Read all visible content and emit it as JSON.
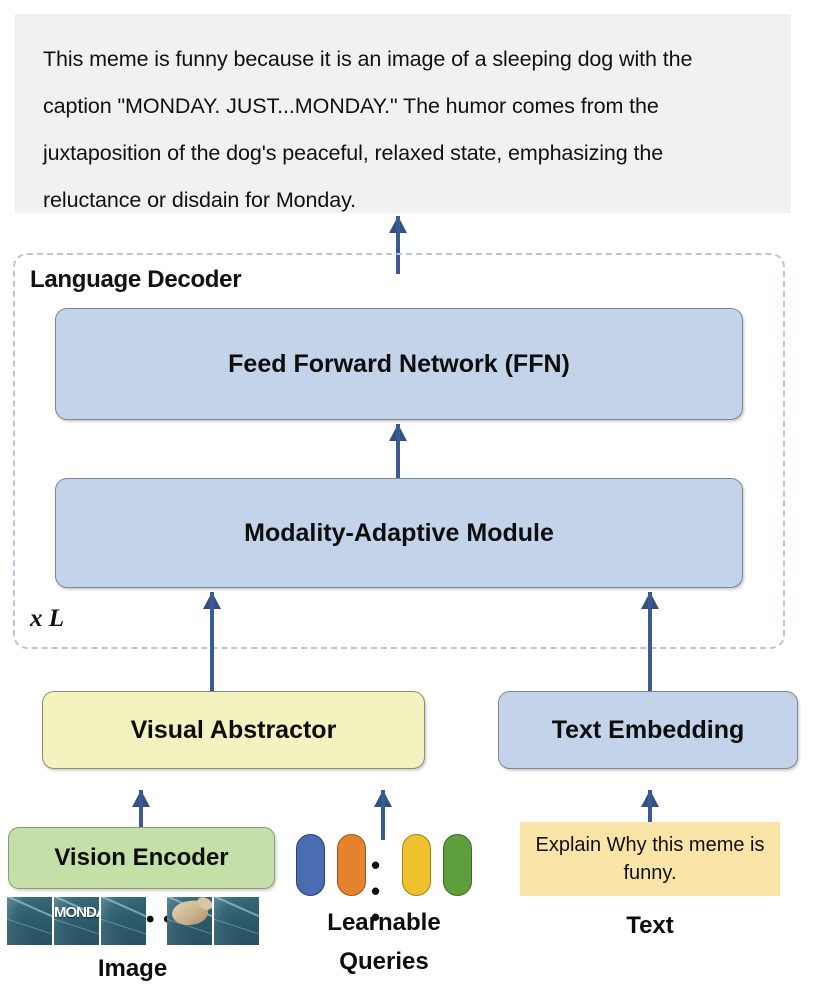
{
  "output": {
    "text": "This meme is funny because it is an image of a sleeping dog with the caption \"MONDAY. JUST...MONDAY.\" The humor comes from the juxtaposition of the dog's peaceful, relaxed state, emphasizing the reluctance or disdain for Monday."
  },
  "decoder": {
    "title": "Language Decoder",
    "repeat_label": "x L",
    "blocks": [
      {
        "label": "Feed Forward Network (FFN)"
      },
      {
        "label": "Modality-Adaptive Module"
      }
    ]
  },
  "encoders": {
    "visual_abstractor": "Visual Abstractor",
    "text_embedding": "Text Embedding",
    "vision_encoder": "Vision Encoder"
  },
  "inputs": {
    "prompt_text": "Explain Why this meme is funny.",
    "image_caption": "Image",
    "queries_caption": "Learnable\nQueries",
    "queries_caption_line1": "Learnable",
    "queries_caption_line2": "Queries",
    "text_caption": "Text",
    "ellipsis": "• • •",
    "thumbnail_caption": "MONDAY"
  },
  "colors": {
    "block_blue": "#c3d4ea",
    "block_yellow": "#f4f3c0",
    "block_green": "#c5dfa8",
    "prompt_yellow": "#fae4a8",
    "arrow_blue": "#3a5a93",
    "dashed_border": "#b9c6d9",
    "output_panel_bg": "#f1f1f1",
    "query_blue": "#4a6cb0",
    "query_orange": "#e5822e",
    "query_yellow": "#f0c12f",
    "query_green": "#5f9e3c"
  }
}
